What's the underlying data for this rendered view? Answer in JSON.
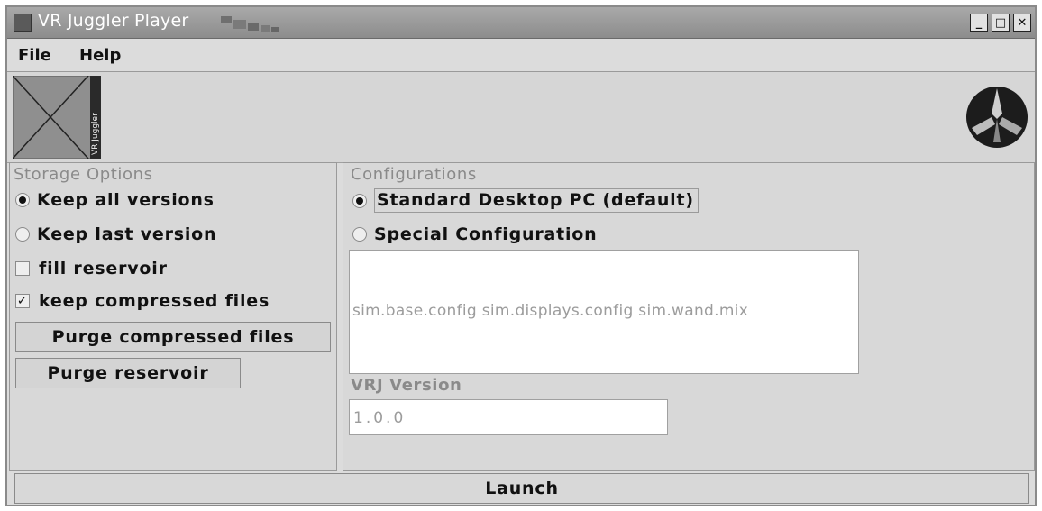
{
  "window": {
    "title": "VR Juggler Player",
    "controls": {
      "minimize": "_",
      "maximize": "□",
      "close": "✕"
    }
  },
  "menu": {
    "file": "File",
    "help": "Help"
  },
  "banner": {
    "left_logo_text": "VR Juggler",
    "left_logo_icon": "vr-juggler-logo",
    "right_logo_icon": "juggler-sphere-logo"
  },
  "storage": {
    "title": "Storage Options",
    "keep_all": "Keep all versions",
    "keep_last": "Keep last version",
    "fill_reservoir": "fill reservoir",
    "keep_compressed": "keep compressed files",
    "purge_compressed": "Purge compressed files",
    "purge_reservoir": "Purge reservoir",
    "keep_all_selected": true,
    "keep_last_selected": false,
    "fill_reservoir_checked": false,
    "keep_compressed_checked": true
  },
  "configurations": {
    "title": "Configurations",
    "standard": "Standard Desktop PC (default)",
    "special": "Special Configuration",
    "standard_selected": true,
    "special_selected": false,
    "files_text": "sim.base.config sim.displays.config sim.wand.mix",
    "vrj_version_label": "VRJ Version",
    "vrj_version_value": "1.0.0"
  },
  "launch": {
    "label": "Launch"
  },
  "colors": {
    "titlebar": "#9a9a9a",
    "window_bg": "#dcdcdc",
    "group_title": "#8a8a8a",
    "field_text": "#9c9c9c"
  }
}
